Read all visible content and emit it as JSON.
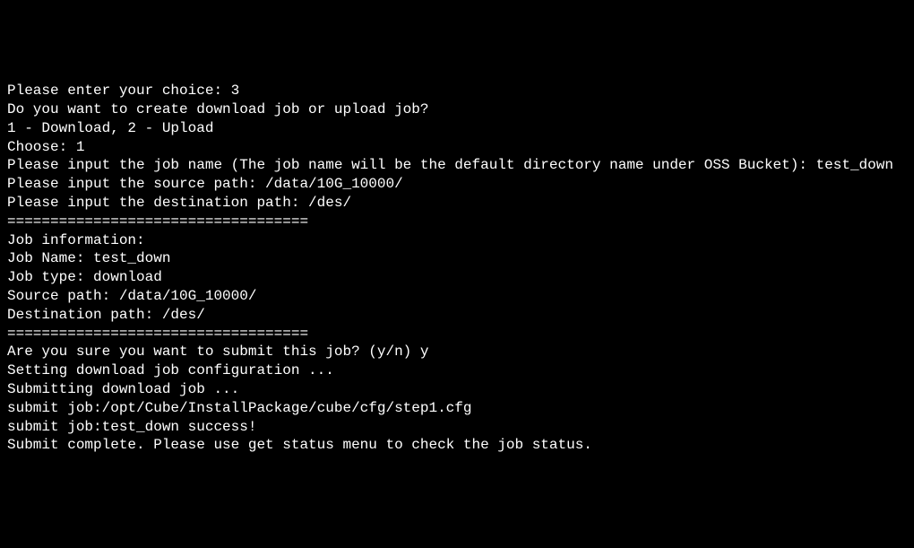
{
  "terminal": {
    "lines": [
      "Please enter your choice: 3",
      "",
      "",
      "Do you want to create download job or upload job?",
      "1 - Download, 2 - Upload",
      "Choose: 1",
      "Please input the job name (The job name will be the default directory name under OSS Bucket): test_down",
      "Please input the source path: /data/10G_10000/",
      "Please input the destination path: /des/",
      "",
      "===================================",
      "Job information:",
      "Job Name: test_down",
      "Job type: download",
      "Source path: /data/10G_10000/",
      "Destination path: /des/",
      "===================================",
      "",
      "Are you sure you want to submit this job? (y/n) y",
      "Setting download job configuration ...",
      "Submitting download job ...",
      "submit job:/opt/Cube/InstallPackage/cube/cfg/step1.cfg",
      "submit job:test_down success!",
      "Submit complete. Please use get status menu to check the job status."
    ]
  }
}
